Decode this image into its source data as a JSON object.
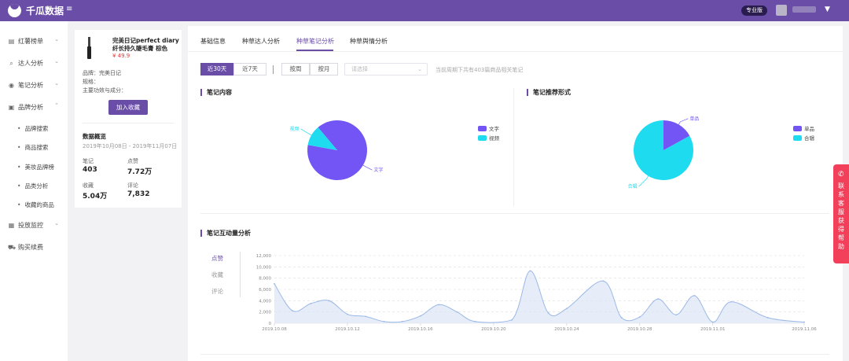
{
  "app": {
    "name": "千瓜数据",
    "plan_badge": "专业版"
  },
  "sidebar": {
    "items": [
      {
        "label": "红薯榜单",
        "icon": "list-icon"
      },
      {
        "label": "达人分析",
        "icon": "search-icon"
      },
      {
        "label": "笔记分析",
        "icon": "note-icon"
      },
      {
        "label": "品牌分析",
        "icon": "brand-icon"
      },
      {
        "label": "投放监控",
        "icon": "monitor-icon"
      },
      {
        "label": "购买续费",
        "icon": "cart-icon"
      }
    ],
    "brand_sub": [
      "品牌搜索",
      "商品搜索",
      "美妆品牌榜",
      "品类分析",
      "收藏的商品"
    ]
  },
  "product": {
    "name": "完美日记perfect diary纤长持久睫毛膏 棕色",
    "price": "¥ 49.9",
    "brand": "品牌：完美日记",
    "spec": "规格：",
    "efficacy": "主要功效与成分：",
    "fav_button": "加入收藏",
    "overview_title": "数据概览",
    "date_range": "2019年10月08日 - 2019年11月07日",
    "stats": [
      {
        "label": "笔记",
        "value": "403"
      },
      {
        "label": "点赞",
        "value": "7.72万"
      },
      {
        "label": "收藏",
        "value": "5.04万"
      },
      {
        "label": "评论",
        "value": "7,832"
      }
    ]
  },
  "tabs": [
    "基础信息",
    "种草达人分析",
    "种草笔记分析",
    "种草舆情分析"
  ],
  "filters": {
    "range": [
      "近30天",
      "近7天"
    ],
    "period": [
      "按周",
      "按月"
    ],
    "select_placeholder": "请选择",
    "select_arrow": "⌄",
    "note": "当前周期下共有403篇商品相关笔记"
  },
  "note_content": {
    "title": "笔记内容",
    "legend": [
      "文字",
      "视频"
    ],
    "labels": {
      "text": "文字",
      "video": "视频"
    }
  },
  "note_form": {
    "title": "笔记推荐形式",
    "legend": [
      "单品",
      "合辑"
    ],
    "labels": {
      "single": "单品",
      "collection": "合辑"
    }
  },
  "interaction": {
    "title": "笔记互动量分析",
    "metrics": [
      "点赞",
      "收藏",
      "评论"
    ]
  },
  "help": {
    "label": "联系客服获得帮助",
    "icon": "phone-icon"
  },
  "colors": {
    "primary": "#6a4da6",
    "text_slice": "#7255f4",
    "video_slice": "#1fdbf0",
    "line": "#9bb8e6"
  },
  "chart_data": [
    {
      "type": "pie",
      "title": "笔记内容",
      "categories": [
        "文字",
        "视频"
      ],
      "values": [
        89,
        11
      ]
    },
    {
      "type": "pie",
      "title": "笔记推荐形式",
      "categories": [
        "单品",
        "合辑"
      ],
      "values": [
        17,
        83
      ]
    },
    {
      "type": "area",
      "title": "笔记互动量分析",
      "series": [
        {
          "name": "点赞",
          "values": [
            7000,
            2200,
            3500,
            4000,
            1600,
            1200,
            300,
            300,
            1300,
            3300,
            2000,
            300,
            600,
            9300,
            1800,
            2600,
            7500,
            1000,
            1100,
            4300,
            1500,
            4900,
            200,
            3800,
            1000,
            200
          ]
        }
      ],
      "x": [
        "2019.10.08",
        "2019.10.09",
        "2019.10.10",
        "2019.10.11",
        "2019.10.12",
        "2019.10.13",
        "2019.10.14",
        "2019.10.15",
        "2019.10.16",
        "2019.10.17",
        "2019.10.18",
        "2019.10.19",
        "2019.10.21",
        "2019.10.22",
        "2019.10.23",
        "2019.10.24",
        "2019.10.26",
        "2019.10.27",
        "2019.10.28",
        "2019.10.29",
        "2019.10.30",
        "2019.10.31",
        "2019.11.01",
        "2019.11.02",
        "2019.11.04",
        "2019.11.06"
      ],
      "x_ticks": [
        "2019.10.08",
        "2019.10.12",
        "2019.10.16",
        "2019.10.20",
        "2019.10.24",
        "2019.10.28",
        "2019.11.01",
        "2019.11.06"
      ],
      "y_ticks": [
        "0",
        "2,000",
        "4,000",
        "6,000",
        "8,000",
        "10,000",
        "12,000"
      ],
      "ylim": [
        0,
        12000
      ],
      "grid": true
    }
  ]
}
